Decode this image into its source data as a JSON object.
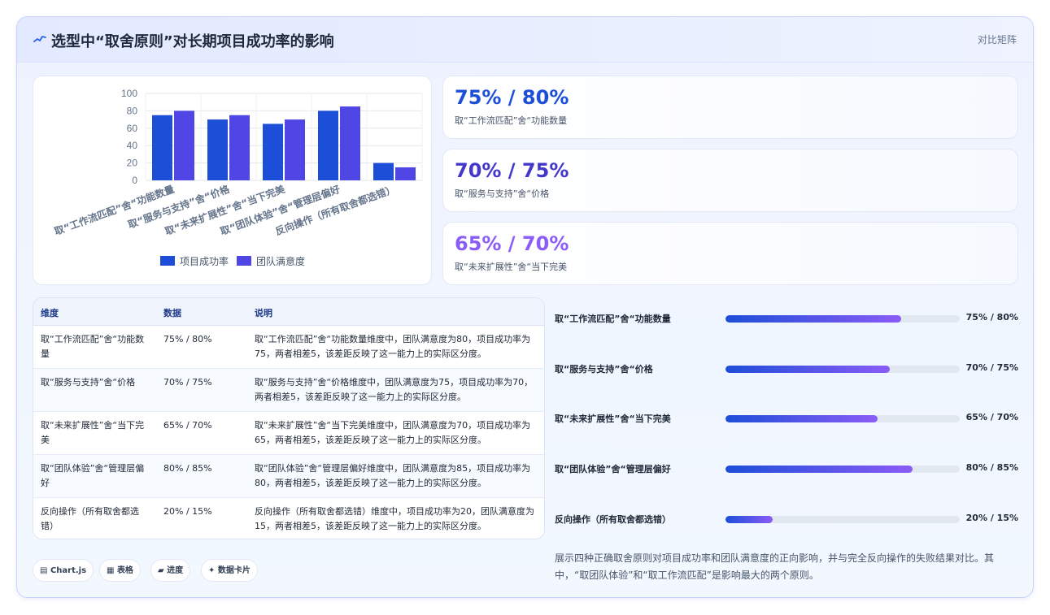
{
  "header": {
    "title": "选型中“取舍原则”对长期项目成功率的影响",
    "link": "对比矩阵",
    "icon": "sparkline-icon"
  },
  "chart_data": {
    "type": "bar",
    "categories": [
      "取“工作流匹配”舍“功能数量",
      "取“服务与支持”舍“价格",
      "取“未来扩展性”舍“当下完美",
      "取“团队体验”舍“管理层偏好",
      "反向操作（所有取舍都选错）"
    ],
    "series": [
      {
        "name": "项目成功率",
        "values": [
          75,
          70,
          65,
          80,
          20
        ],
        "color": "#1d4ed8"
      },
      {
        "name": "团队满意度",
        "values": [
          80,
          75,
          70,
          85,
          15
        ],
        "color": "#4f46e5"
      }
    ],
    "ylim": [
      0,
      100
    ],
    "yticks": [
      0,
      20,
      40,
      60,
      80,
      100
    ],
    "grid": true,
    "legend": "bottom"
  },
  "stats": [
    {
      "value": "75% / 80%",
      "label": "取“工作流匹配”舍“功能数量",
      "color": "#1d4ed8"
    },
    {
      "value": "70% / 75%",
      "label": "取“服务与支持”舍“价格",
      "color": "#4338ca"
    },
    {
      "value": "65% / 70%",
      "label": "取“未来扩展性”舍“当下完美",
      "color": "#8b5cf6"
    }
  ],
  "table": {
    "headers": [
      "维度",
      "数据",
      "说明"
    ],
    "rows": [
      {
        "dim": "取“工作流匹配”舍“功能数量",
        "data": "75% / 80%",
        "desc": "取“工作流匹配”舍“功能数量维度中，团队满意度为80，项目成功率为75，两者相差5，该差距反映了这一能力上的实际区分度。"
      },
      {
        "dim": "取“服务与支持”舍“价格",
        "data": "70% / 75%",
        "desc": "取“服务与支持”舍“价格维度中，团队满意度为75，项目成功率为70，两者相差5，该差距反映了这一能力上的实际区分度。"
      },
      {
        "dim": "取“未来扩展性”舍“当下完美",
        "data": "65% / 70%",
        "desc": "取“未来扩展性”舍“当下完美维度中，团队满意度为70，项目成功率为65，两者相差5，该差距反映了这一能力上的实际区分度。"
      },
      {
        "dim": "取“团队体验”舍“管理层偏好",
        "data": "80% / 85%",
        "desc": "取“团队体验”舍“管理层偏好维度中，团队满意度为85，项目成功率为80，两者相差5，该差距反映了这一能力上的实际区分度。"
      },
      {
        "dim": "反向操作（所有取舍都选错）",
        "data": "20% / 15%",
        "desc": "反向操作（所有取舍都选错）维度中，项目成功率为20，团队满意度为15，两者相差5，该差距反映了这一能力上的实际区分度。"
      }
    ]
  },
  "progress": [
    {
      "label": "取“工作流匹配”舍“功能数量",
      "value": "75% / 80%",
      "fill": 0.75
    },
    {
      "label": "取“服务与支持”舍“价格",
      "value": "70% / 75%",
      "fill": 0.7
    },
    {
      "label": "取“未来扩展性”舍“当下完美",
      "value": "65% / 70%",
      "fill": 0.65
    },
    {
      "label": "取“团队体验”舍“管理层偏好",
      "value": "80% / 85%",
      "fill": 0.8
    },
    {
      "label": "反向操作（所有取舍都选错）",
      "value": "20% / 15%",
      "fill": 0.2
    }
  ],
  "tags": [
    "Chart.js",
    "表格",
    "进度",
    "数据卡片"
  ],
  "note": "展示四种正确取舍原则对项目成功率和团队满意度的正向影响，并与完全反向操作的失败结果对比。其中，“取团队体验”和“取工作流匹配”是影响最大的两个原则。"
}
